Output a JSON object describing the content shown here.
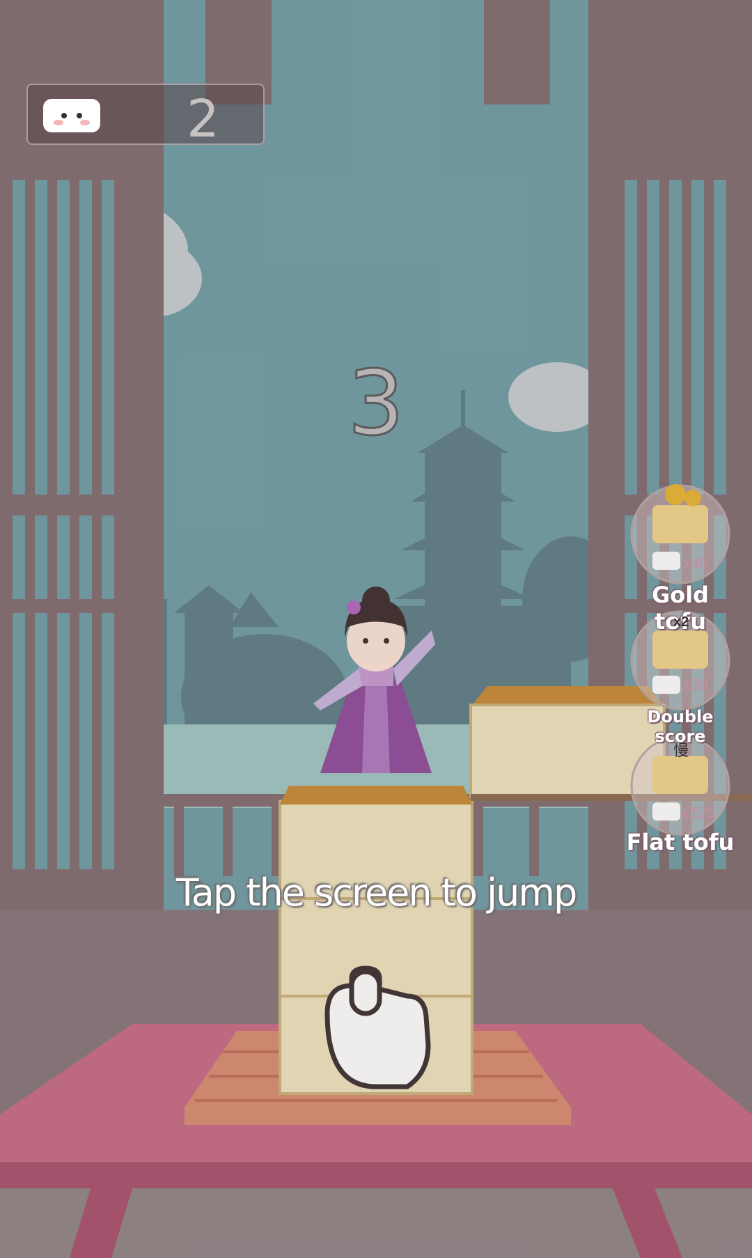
{
  "hud": {
    "coins": "2",
    "coin_icon": "tofu-coin-icon"
  },
  "countdown": "3",
  "instruction": "Tap the screen to jump",
  "powerups": [
    {
      "label": "Gold tofu",
      "cost": "x40",
      "icon": "gold-tofu-icon"
    },
    {
      "label": "Double score",
      "cost": "x30",
      "badge": "x2",
      "icon": "double-score-tofu-icon"
    },
    {
      "label": "Flat tofu",
      "cost": "x125",
      "badge": "慢",
      "icon": "flat-tofu-icon"
    }
  ],
  "colors": {
    "sky": "#6f9ea6",
    "frame": "#806c6f",
    "table": "#c66c86",
    "tofu": "#efe4bf",
    "tofu_top": "#c68a35"
  }
}
